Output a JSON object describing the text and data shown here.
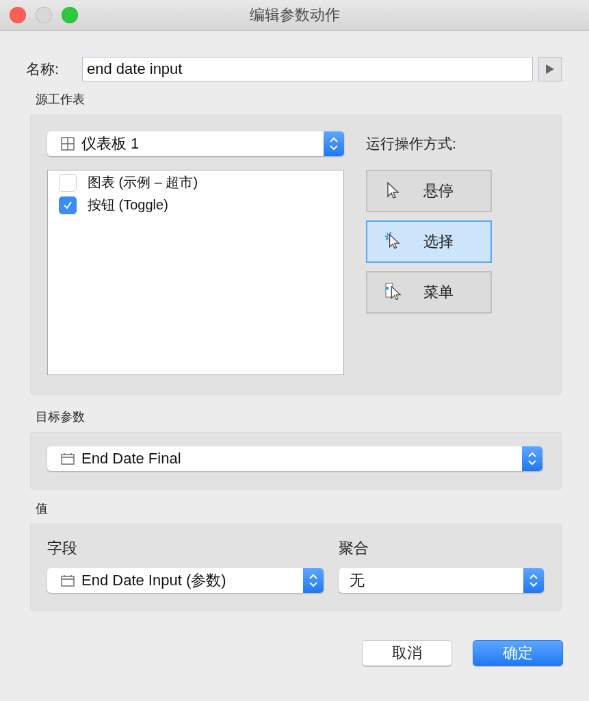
{
  "window": {
    "title": "编辑参数动作"
  },
  "name": {
    "label": "名称:",
    "value": "end date input"
  },
  "source": {
    "label": "源工作表",
    "dropdown": "仪表板 1",
    "sheets": [
      {
        "label": "图表 (示例 – 超市)",
        "checked": false
      },
      {
        "label": "按钮 (Toggle)",
        "checked": true
      }
    ],
    "run_label": "运行操作方式:",
    "run_options": [
      {
        "kind": "hover",
        "label": "悬停",
        "selected": false
      },
      {
        "kind": "select",
        "label": "选择",
        "selected": true
      },
      {
        "kind": "menu",
        "label": "菜单",
        "selected": false
      }
    ]
  },
  "target": {
    "label": "目标参数",
    "dropdown": "End Date Final"
  },
  "value": {
    "label": "值",
    "field_label": "字段",
    "field": "End Date Input (参数)",
    "agg_label": "聚合",
    "agg": "无"
  },
  "buttons": [
    {
      "label": "取消",
      "primary": false
    },
    {
      "label": "确定",
      "primary": true
    }
  ]
}
